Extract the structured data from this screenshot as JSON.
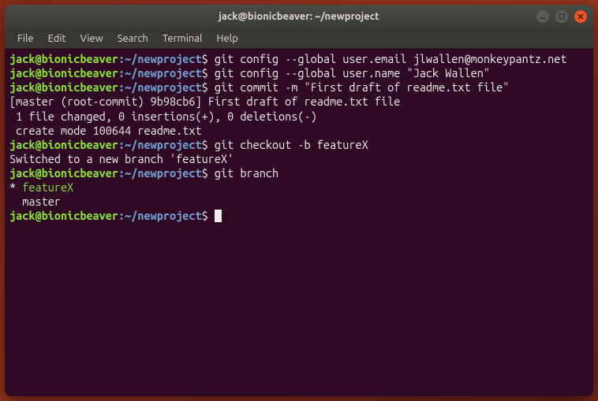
{
  "window": {
    "title": "jack@bionicbeaver: ~/newproject"
  },
  "menu": {
    "file": "File",
    "edit": "Edit",
    "view": "View",
    "search": "Search",
    "terminal": "Terminal",
    "help": "Help"
  },
  "prompt": {
    "user_host": "jack@bionicbeaver",
    "sep": ":",
    "path": "~/newproject",
    "dollar": "$"
  },
  "lines": {
    "cmd1": " git config --global user.email jlwallen@monkeypantz.net",
    "cmd2": " git config --global user.name \"Jack Wallen\"",
    "cmd3": " git commit -m \"First draft of readme.txt file\"",
    "out3a": "[master (root-commit) 9b98cb6] First draft of readme.txt file",
    "out3b": " 1 file changed, 0 insertions(+), 0 deletions(-)",
    "out3c": " create mode 100644 readme.txt",
    "cmd4": " git checkout -b featureX",
    "out4": "Switched to a new branch 'featureX'",
    "cmd5": " git branch",
    "out5a_prefix": "* ",
    "out5a_branch": "featureX",
    "out5b": "  master",
    "cmd6": " "
  }
}
